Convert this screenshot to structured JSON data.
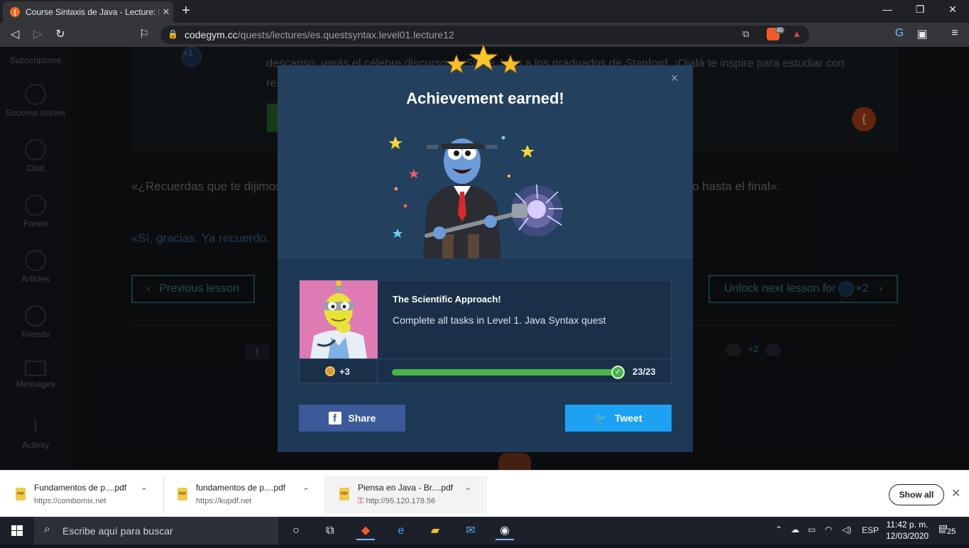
{
  "browser": {
    "tab_title": "Course Sintaxis de Java - Lecture: D",
    "new_tab": "+",
    "url_host": "codegym.cc",
    "url_path": "/quests/lectures/es.questsyntax.level01.lecture12",
    "brave_count": "40"
  },
  "sidebar": {
    "items": [
      {
        "label": "Subscriptions",
        "icon": "subscriptions-icon"
      },
      {
        "label": "Success stories",
        "icon": "flag-icon"
      },
      {
        "label": "Chat",
        "icon": "chat-icon"
      },
      {
        "label": "Forum",
        "icon": "forum-icon"
      },
      {
        "label": "Articles",
        "icon": "articles-icon"
      },
      {
        "label": "Friends",
        "icon": "friends-icon"
      },
      {
        "label": "Messages",
        "icon": "envelope-icon"
      },
      {
        "label": "Activity",
        "icon": "activity-icon"
      }
    ]
  },
  "lesson": {
    "x1_label": "×1",
    "bg_line1": "descanso, verás el célebre discurso de Steve Jobs a los graduados de Stanford. ¡Ojalá te inspire para estudiar con",
    "bg_line2": "re",
    "paragraph1": "«¿Recuerdas que te dijimos que había un video genial? Aquí lo tienes, así que no olvides que debes verlo hasta el final».",
    "paragraph2": "«Sí, gracias. Ya recuerdo.",
    "prev_button": "Previous lesson",
    "next_button": "Unlock next lesson for",
    "next_cost": "×2",
    "votes": "+2"
  },
  "modal": {
    "title": "Achievement earned!",
    "close": "×",
    "achievement_name": "The Scientific Approach!",
    "achievement_desc": "Complete all tasks in Level 1. Java Syntax quest",
    "reward": "+3",
    "progress_text": "23/23",
    "progress_fraction": 1.0,
    "share_label": "Share",
    "tweet_label": "Tweet",
    "colors": {
      "share": "#3c5a99",
      "tweet": "#1da1f2",
      "progress": "#4cb34a"
    }
  },
  "downloads": {
    "items": [
      {
        "file": "Fundamentos de p....pdf",
        "source": "https://combomix.net"
      },
      {
        "file": "fundamentos de p....pdf",
        "source": "https://kupdf.net"
      },
      {
        "file": "Piensa en Java - Br....pdf",
        "source": "http://95.120.178.56"
      }
    ],
    "show_all": "Show all"
  },
  "taskbar": {
    "search_placeholder": "Escribe aquí para buscar",
    "language": "ESP",
    "time": "11:42 p. m.",
    "date": "12/03/2020",
    "notifications": "25"
  }
}
